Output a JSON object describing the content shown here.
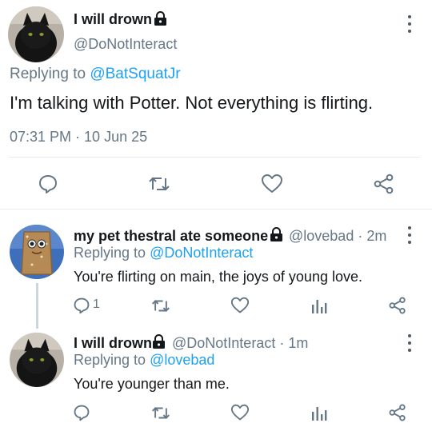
{
  "main_tweet": {
    "display_name": "I will drown",
    "handle": "@DoNotInteract",
    "replying_prefix": "Replying to ",
    "replying_to": "@BatSquatJr",
    "text": "I'm talking with Potter. Not everything is flirting.",
    "timestamp": "07:31 PM · 10 Jun 25"
  },
  "replies": [
    {
      "display_name": "my pet thestral ate someone",
      "handle_time": "@lovebad · 2m",
      "replying_prefix": "Replying to ",
      "replying_to": "@DoNotInteract",
      "text": "You're flirting on main, the joys of young love.",
      "reply_count": "1"
    },
    {
      "display_name": "I will drown",
      "handle_time": "@DoNotInteract · 1m",
      "replying_prefix": "Replying to ",
      "replying_to": "@lovebad",
      "text": "You're younger than me.",
      "reply_count": ""
    }
  ],
  "icons": {
    "reply": "speech-bubble-icon",
    "retweet": "retweet-icon",
    "like": "heart-icon",
    "share": "share-icon",
    "analytics": "analytics-icon",
    "lock": "lock-icon",
    "more": "more-vertical-icon"
  },
  "colors": {
    "accent": "#1da1f2",
    "secondary_text": "#657786",
    "primary_text": "#14171a",
    "action_icon": "#657786",
    "thread_line": "#ccd6dd"
  }
}
